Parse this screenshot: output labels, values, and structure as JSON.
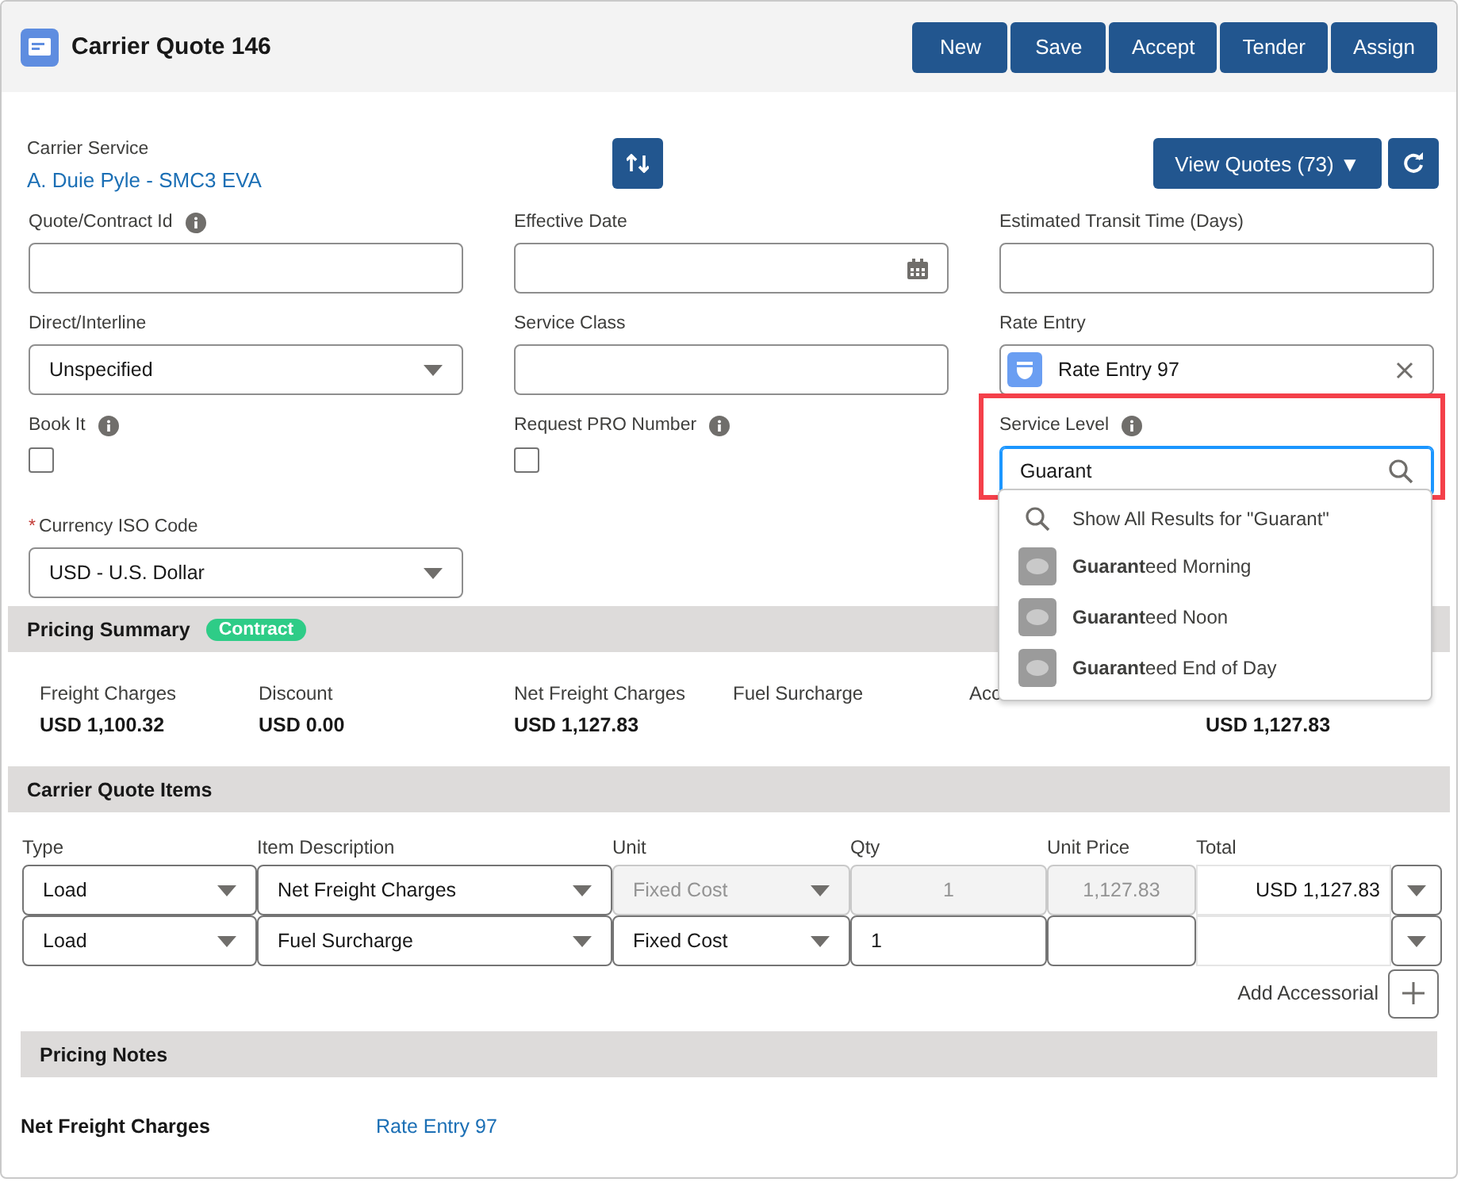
{
  "header": {
    "title": "Carrier Quote 146",
    "buttons": [
      "New",
      "Save",
      "Accept",
      "Tender",
      "Assign"
    ]
  },
  "carrier_service": {
    "label": "Carrier Service",
    "value": "A. Duie Pyle - SMC3 EVA"
  },
  "view_quotes_button": "View Quotes (73) ▼",
  "fields": [
    {
      "kind": "text",
      "label": "Quote/Contract Id",
      "info": true
    },
    {
      "kind": "date",
      "label": "Effective Date",
      "info": false
    },
    {
      "kind": "text",
      "label": "Estimated Transit Time (Days)",
      "info": false
    },
    {
      "kind": "select",
      "label": "Direct/Interline",
      "info": false,
      "value": "Unspecified"
    },
    {
      "kind": "text",
      "label": "Service Class",
      "info": false
    },
    {
      "kind": "lookup",
      "label": "Rate Entry",
      "info": false,
      "value": "Rate Entry 97"
    },
    {
      "kind": "checkbox",
      "label": "Book It",
      "info": true,
      "checked": false
    },
    {
      "kind": "checkbox",
      "label": "Request PRO Number",
      "info": true,
      "checked": false
    },
    {
      "kind": "search",
      "label": "Service Level",
      "info": true,
      "value": "Guarant",
      "highlighted": true
    },
    {
      "kind": "select",
      "label": "Currency ISO Code",
      "info": false,
      "required_mark": "*",
      "value": "USD - U.S. Dollar"
    }
  ],
  "service_level_suggestions": {
    "show_all": "Show All Results for \"Guarant\"",
    "items": [
      "**Guarant**eed Morning",
      "**Guarant**eed Noon",
      "**Guarant**eed End of Day"
    ]
  },
  "pricing_summary": {
    "title": "Pricing Summary",
    "badge": "Contract",
    "items": [
      {
        "label": "Freight Charges",
        "value": "USD 1,100.32"
      },
      {
        "label": "Discount",
        "value": "USD 0.00"
      },
      {
        "label": "Net Freight Charges",
        "value": "USD 1,127.83"
      },
      {
        "label": "Fuel Surcharge"
      },
      {
        "label": "Acc"
      },
      {
        "value": "USD 1,127.83"
      }
    ]
  },
  "carrier_quote_items": {
    "title": "Carrier Quote Items",
    "columns": [
      "Type",
      "Item Description",
      "Unit",
      "Qty",
      "Unit Price",
      "Total"
    ],
    "rows": [
      {
        "cells": [
          {
            "kind": "select",
            "value": "Load",
            "disabled": false
          },
          {
            "kind": "select",
            "value": "Net Freight Charges",
            "disabled": false
          },
          {
            "kind": "select",
            "value": "Fixed Cost",
            "disabled": true
          },
          {
            "kind": "input",
            "value": "1",
            "disabled": true
          },
          {
            "kind": "input",
            "value": "1,127.83",
            "disabled": true
          },
          {
            "kind": "total",
            "value": "USD 1,127.83"
          }
        ]
      },
      {
        "cells": [
          {
            "kind": "select",
            "value": "Load",
            "disabled": false
          },
          {
            "kind": "select",
            "value": "Fuel Surcharge",
            "disabled": false
          },
          {
            "kind": "select",
            "value": "Fixed Cost",
            "disabled": false
          },
          {
            "kind": "input",
            "value": "1",
            "disabled": false
          },
          {
            "kind": "input",
            "disabled": false
          },
          {
            "kind": "total"
          }
        ]
      }
    ],
    "add_label": "Add Accessorial"
  },
  "pricing_notes": {
    "title": "Pricing Notes",
    "rows": [
      {
        "label": "Net Freight Charges",
        "link": "Rate Entry 97"
      }
    ]
  }
}
